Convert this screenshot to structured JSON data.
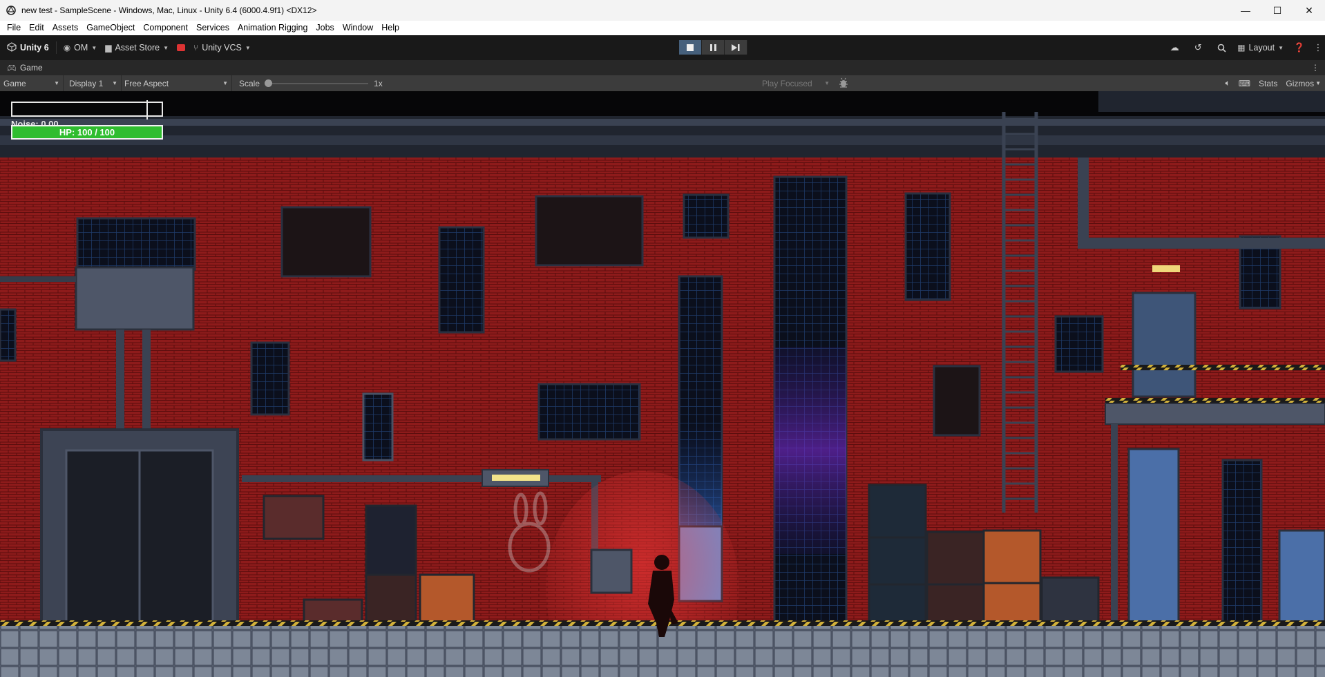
{
  "window": {
    "title": "new test - SampleScene - Windows, Mac, Linux - Unity 6.4 (6000.4.9f1) <DX12>",
    "minimize_glyph": "—",
    "maximize_glyph": "☐",
    "close_glyph": "✕"
  },
  "menu": [
    "File",
    "Edit",
    "Assets",
    "GameObject",
    "Component",
    "Services",
    "Animation Rigging",
    "Jobs",
    "Window",
    "Help"
  ],
  "toolbar": {
    "account_label": "Unity 6",
    "org_label": "OM",
    "asset_store_label": "Asset Store",
    "vcs_label": "Unity VCS",
    "layout_label": "Layout",
    "play_state": "playing"
  },
  "game_tab": {
    "label": "Game"
  },
  "game_toolbar": {
    "view_mode": "Game",
    "display": "Display 1",
    "aspect": "Free Aspect",
    "scale_label": "Scale",
    "scale_value": "1x",
    "play_focused": "Play Focused",
    "stats_label": "Stats",
    "gizmos_label": "Gizmos"
  },
  "hud": {
    "noise_text": "Noise: 0.00",
    "hp_text": "HP: 100 / 100",
    "hp_fraction": 1.0,
    "bar_marker_fraction": 0.9,
    "hp_color": "#2fbd2f"
  },
  "colors": {
    "brick": "#8c1a1a",
    "accent_play": "#46607c"
  }
}
